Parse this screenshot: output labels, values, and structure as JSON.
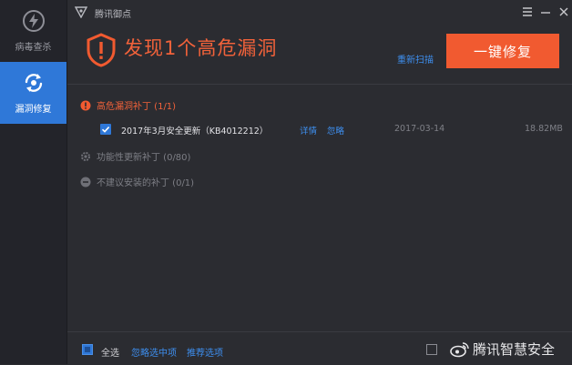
{
  "colors": {
    "accent_red": "#f15a30",
    "accent_blue": "#2f78d8",
    "link_blue": "#3e8ff0"
  },
  "sidebar": {
    "items": [
      {
        "label": "病毒查杀",
        "icon": "lightning-shield-icon",
        "active": false
      },
      {
        "label": "漏洞修复",
        "icon": "refresh-repair-icon",
        "active": true
      }
    ]
  },
  "titlebar": {
    "title": "腾讯御点"
  },
  "header": {
    "headline": "发现1个高危漏洞",
    "rescan_label": "重新扫描",
    "fix_button_label": "一键修复"
  },
  "groups": [
    {
      "label": "高危漏洞补丁 (1/1)",
      "icon": "warning-circle-icon"
    },
    {
      "label": "功能性更新补丁 (0/80)",
      "icon": "gear-icon"
    },
    {
      "label": "不建议安装的补丁 (0/1)",
      "icon": "minus-circle-icon"
    }
  ],
  "patch": {
    "name": "2017年3月安全更新（KB4012212）",
    "details_label": "详情",
    "ignore_label": "忽略",
    "date": "2017-03-14",
    "size": "18.82MB",
    "checked": true
  },
  "footer": {
    "select_all_label": "全选",
    "ignore_selected_label": "忽略选中项",
    "recommended_label": "推荐选项"
  },
  "watermark": {
    "text": "腾讯智慧安全"
  }
}
